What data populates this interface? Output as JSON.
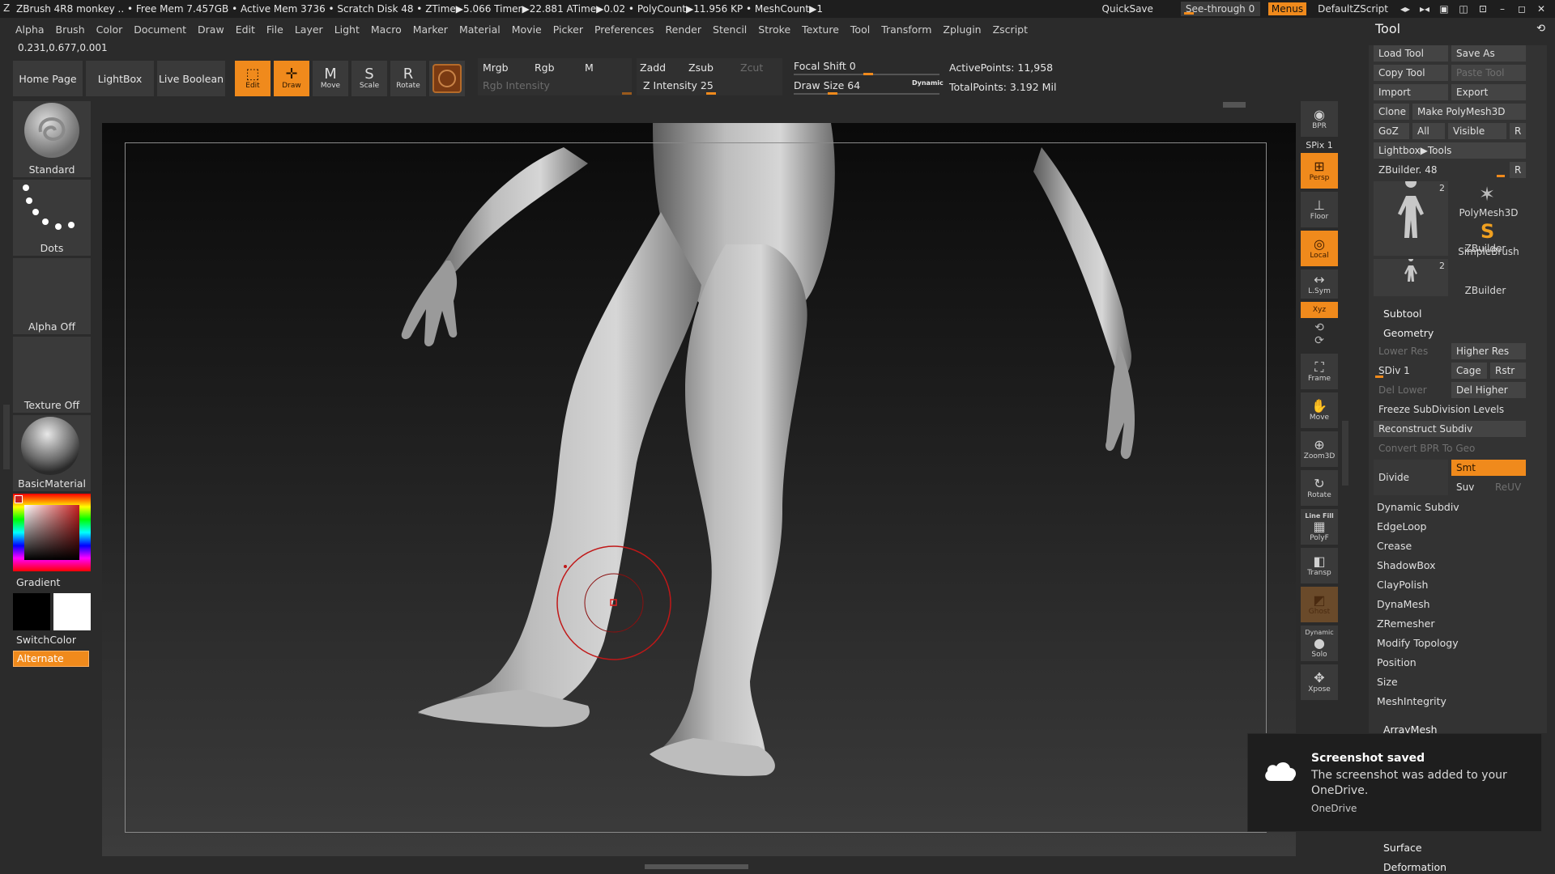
{
  "titlebar": {
    "title": "ZBrush 4R8   monkey  ..  • Free Mem 7.457GB • Active Mem 3736 • Scratch Disk 48 •  ZTime▶5.066 Timer▶22.881 ATime▶0.02 • PolyCount▶11.956 KP  • MeshCount▶1",
    "quicksave": "QuickSave",
    "seethrough": "See-through  0",
    "menus": "Menus",
    "script": "DefaultZScript"
  },
  "menu": [
    "Alpha",
    "Brush",
    "Color",
    "Document",
    "Draw",
    "Edit",
    "File",
    "Layer",
    "Light",
    "Macro",
    "Marker",
    "Material",
    "Movie",
    "Picker",
    "Preferences",
    "Render",
    "Stencil",
    "Stroke",
    "Texture",
    "Tool",
    "Transform",
    "Zplugin",
    "Zscript"
  ],
  "coords": "0.231,0.677,0.001",
  "toolbar": {
    "home": "Home Page",
    "lightbox": "LightBox",
    "liveboolean": "Live Boolean",
    "edit": "Edit",
    "draw": "Draw",
    "move": "Move",
    "scale": "Scale",
    "rotate": "Rotate",
    "mrgb": "Mrgb",
    "rgb": "Rgb",
    "m": "M",
    "rgb_intensity": "Rgb Intensity",
    "zadd": "Zadd",
    "zsub": "Zsub",
    "zcut": "Zcut",
    "z_intensity": "Z Intensity 25",
    "focal_shift": "Focal Shift 0",
    "draw_size": "Draw Size 64",
    "dynamic": "Dynamic",
    "active_points": "ActivePoints: 11,958",
    "total_points": "TotalPoints: 3.192 Mil"
  },
  "left": {
    "brush": "Standard",
    "stroke": "Dots",
    "alpha": "Alpha Off",
    "texture": "Texture Off",
    "material": "BasicMaterial",
    "gradient": "Gradient",
    "switchcolor": "SwitchColor",
    "alternate": "Alternate"
  },
  "right": {
    "bpr": "BPR",
    "spix": "SPix 1",
    "persp": "Persp",
    "floor": "Floor",
    "local": "Local",
    "lsym": "L.Sym",
    "xyz": "Xyz",
    "frame": "Frame",
    "move": "Move",
    "zoom3d": "Zoom3D",
    "rotate": "Rotate",
    "linefill": "Line Fill",
    "polyf": "PolyF",
    "transp": "Transp",
    "ghost": "Ghost",
    "dynamic": "Dynamic",
    "solo": "Solo",
    "xpose": "Xpose"
  },
  "tool": {
    "title": "Tool",
    "load": "Load Tool",
    "saveas": "Save As",
    "copy": "Copy Tool",
    "paste": "Paste Tool",
    "import": "Import",
    "export": "Export",
    "clone": "Clone",
    "make": "Make PolyMesh3D",
    "goz": "GoZ",
    "all": "All",
    "visible": "Visible",
    "r": "R",
    "lightbox_tools": "Lightbox▶Tools",
    "zbuilder_slider": "ZBuilder. 48",
    "thumbs": [
      {
        "label": "ZBuilder",
        "count": "2"
      },
      {
        "label": "PolyMesh3D",
        "count": ""
      },
      {
        "label": "SimpleBrush",
        "count": ""
      },
      {
        "label": "ZBuilder",
        "count": "2"
      }
    ],
    "subtool": "Subtool",
    "geometry": "Geometry",
    "lower_res": "Lower Res",
    "higher_res": "Higher Res",
    "sdiv": "SDiv 1",
    "cage": "Cage",
    "rstr": "Rstr",
    "del_lower": "Del Lower",
    "del_higher": "Del Higher",
    "freeze": "Freeze SubDivision Levels",
    "reconstruct": "Reconstruct Subdiv",
    "convert_bpr": "Convert BPR To Geo",
    "divide": "Divide",
    "smt": "Smt",
    "suv": "Suv",
    "reuv": "ReUV",
    "items": [
      "Dynamic Subdiv",
      "EdgeLoop",
      "Crease",
      "ShadowBox",
      "ClayPolish",
      "DynaMesh",
      "ZRemesher",
      "Modify Topology",
      "Position",
      "Size",
      "MeshIntegrity"
    ],
    "arraymesh": "ArrayMesh",
    "surface": "Surface",
    "deformation": "Deformation"
  },
  "toast": {
    "title": "Screenshot saved",
    "body": "The screenshot was added to your OneDrive.",
    "source": "OneDrive"
  },
  "colors": {
    "accent": "#f08a1c",
    "panel": "#2b2b2b",
    "viewport": "#121212"
  }
}
